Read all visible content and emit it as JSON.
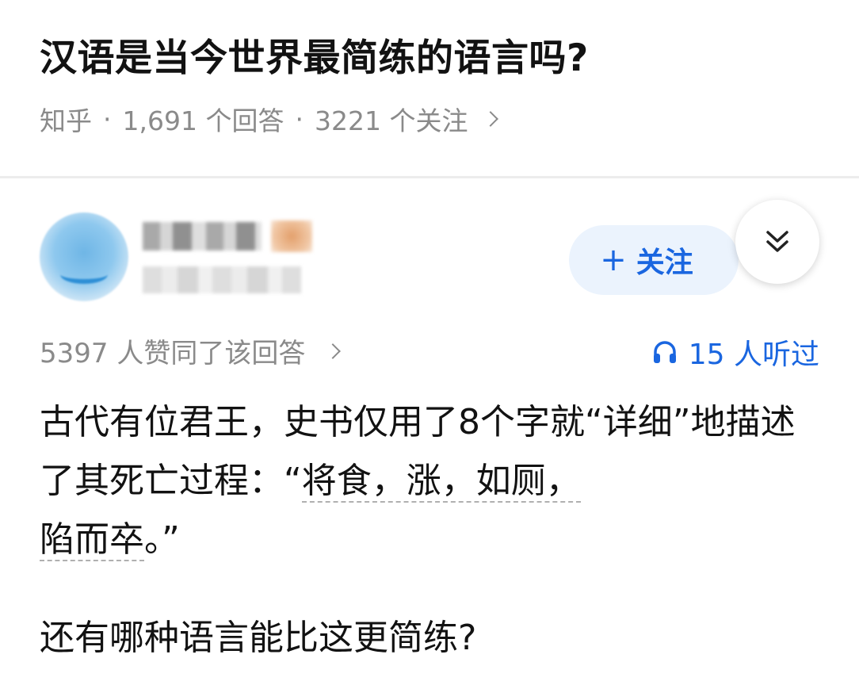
{
  "question": {
    "title": "汉语是当今世界最简练的语言吗?",
    "source": "知乎",
    "separator": "·",
    "answers": "1,691 个回答",
    "followers": "3221 个关注"
  },
  "author": {
    "follow_label": "关注",
    "follow_plus": "+"
  },
  "answer": {
    "upvotes": "5397 人赞同了该回答",
    "listens": "15 人听过",
    "para1_a": "古代有位君王，史书仅用了8个字就“详细”地描述了其死亡过程：“",
    "para1_quote_a": "将食，涨，如厕，",
    "para1_quote_b": "陷而卒",
    "para1_end": "。”",
    "para2": "还有哪种语言能比这更简练?"
  },
  "icons": {
    "expand": "double-chevron-down-icon",
    "headphones": "headphones-icon",
    "chevron": "chevron-right-icon"
  },
  "colors": {
    "accent": "#1a66e0",
    "meta": "#8a8a8a",
    "follow_bg": "#ebf3fd"
  }
}
